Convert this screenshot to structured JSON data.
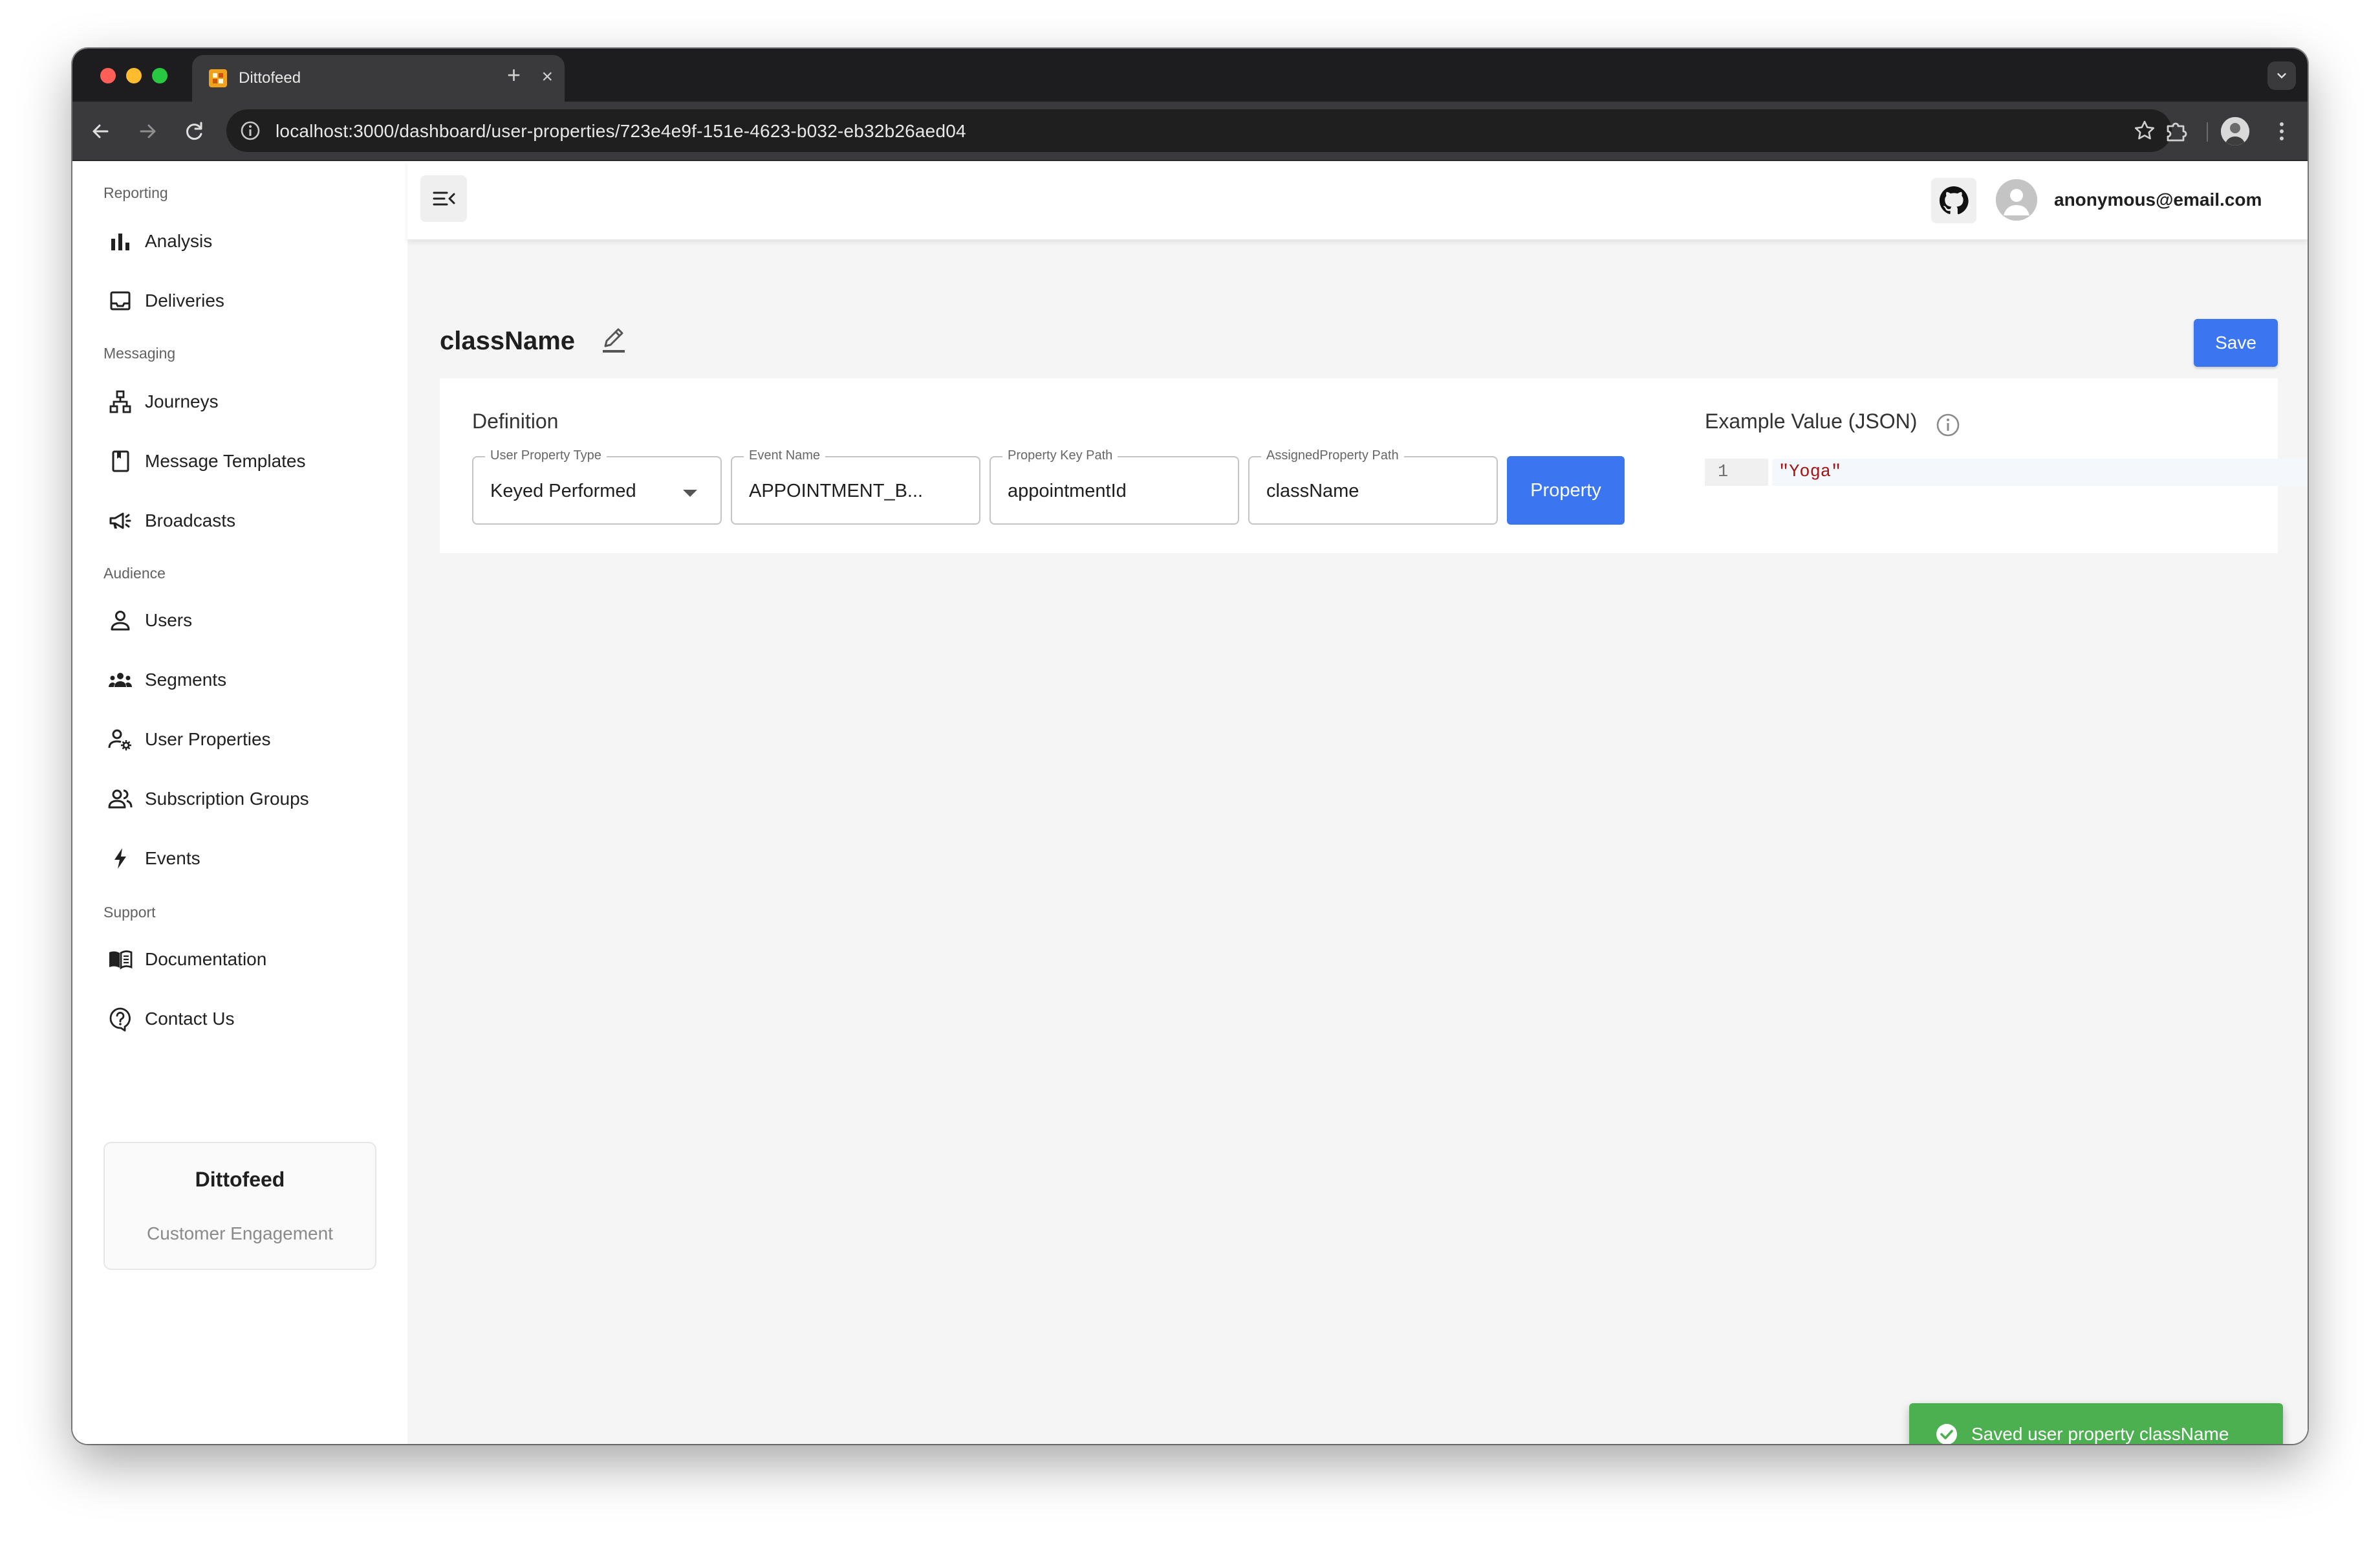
{
  "browser": {
    "tab_title": "Dittofeed",
    "tab_close": "×",
    "new_tab": "+",
    "url": "localhost:3000/dashboard/user-properties/723e4e9f-151e-4623-b032-eb32b26aed04"
  },
  "sidebar": {
    "sections": [
      {
        "label": "Reporting",
        "items": [
          {
            "label": "Analysis",
            "icon": "bar-chart-icon"
          },
          {
            "label": "Deliveries",
            "icon": "inbox-icon"
          }
        ]
      },
      {
        "label": "Messaging",
        "items": [
          {
            "label": "Journeys",
            "icon": "sitemap-icon"
          },
          {
            "label": "Message Templates",
            "icon": "book-icon"
          },
          {
            "label": "Broadcasts",
            "icon": "megaphone-icon"
          }
        ]
      },
      {
        "label": "Audience",
        "items": [
          {
            "label": "Users",
            "icon": "user-icon"
          },
          {
            "label": "Segments",
            "icon": "group-icon"
          },
          {
            "label": "User Properties",
            "icon": "user-gear-icon"
          },
          {
            "label": "Subscription Groups",
            "icon": "users-icon"
          },
          {
            "label": "Events",
            "icon": "bolt-icon"
          }
        ]
      },
      {
        "label": "Support",
        "items": [
          {
            "label": "Documentation",
            "icon": "open-book-icon"
          },
          {
            "label": "Contact Us",
            "icon": "help-circle-icon"
          }
        ]
      }
    ],
    "brand": {
      "name": "Dittofeed",
      "tagline": "Customer Engagement"
    }
  },
  "header": {
    "user_email": "anonymous@email.com"
  },
  "page": {
    "title": "className",
    "save_label": "Save",
    "definition_heading": "Definition",
    "fields": {
      "user_property_type": {
        "label": "User Property Type",
        "value": "Keyed Performed"
      },
      "event_name": {
        "label": "Event Name",
        "value": "APPOINTMENT_B..."
      },
      "property_key_path": {
        "label": "Property Key Path",
        "value": "appointmentId"
      },
      "assigned_property_path": {
        "label": "AssignedProperty Path",
        "value": "className"
      }
    },
    "property_button": "Property",
    "example_heading": "Example Value (JSON)",
    "example_code": {
      "line_number": "1",
      "value": "\"Yoga\""
    }
  },
  "snackbar": {
    "message": "Saved user property className"
  },
  "colors": {
    "primary": "#3b76f0",
    "success": "#4caf50",
    "string_literal": "#a31515"
  }
}
